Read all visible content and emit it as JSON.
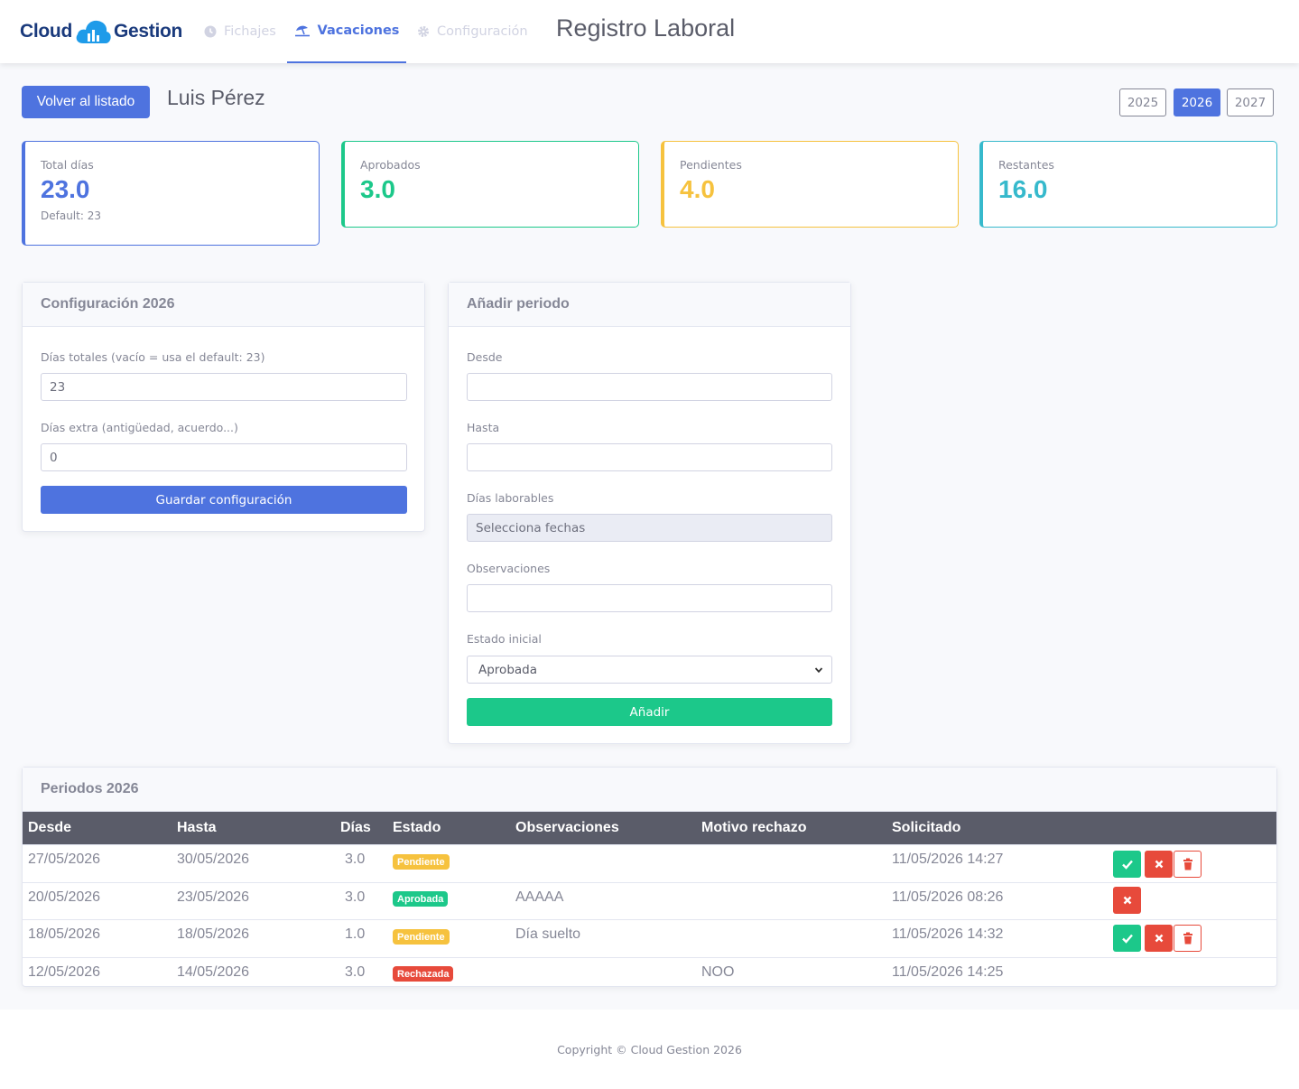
{
  "app": {
    "logo_left": "Cloud",
    "logo_right": "Gestion",
    "page_title": "Registro Laboral"
  },
  "nav": {
    "fichajes": "Fichajes",
    "vacaciones": "Vacaciones",
    "configuracion": "Configuración"
  },
  "header": {
    "back_label": "Volver al listado",
    "employee_name": "Luis Pérez",
    "years": [
      "2025",
      "2026",
      "2027"
    ],
    "active_year": "2026"
  },
  "stats": {
    "total": {
      "label": "Total días",
      "value": "23.0",
      "sub": "Default: 23",
      "color": "#4e73df"
    },
    "aprobados": {
      "label": "Aprobados",
      "value": "3.0",
      "color": "#1cc88a"
    },
    "pendientes": {
      "label": "Pendientes",
      "value": "4.0",
      "color": "#f6c23e"
    },
    "restantes": {
      "label": "Restantes",
      "value": "16.0",
      "color": "#36b9cc"
    }
  },
  "config_card": {
    "title": "Configuración 2026",
    "dias_totales_label": "Días totales (vacío = usa el default: 23)",
    "dias_totales_value": "23",
    "dias_extra_label": "Días extra (antigüedad, acuerdo...)",
    "dias_extra_value": "0",
    "save_label": "Guardar configuración"
  },
  "add_card": {
    "title": "Añadir periodo",
    "desde_label": "Desde",
    "desde_value": "",
    "hasta_label": "Hasta",
    "hasta_value": "",
    "laborables_label": "Días laborables",
    "laborables_value": "Selecciona fechas",
    "observaciones_label": "Observaciones",
    "observaciones_value": "",
    "estado_label": "Estado inicial",
    "estado_value": "Aprobada",
    "add_label": "Añadir"
  },
  "periods": {
    "title": "Periodos 2026",
    "columns": [
      "Desde",
      "Hasta",
      "Días",
      "Estado",
      "Observaciones",
      "Motivo rechazo",
      "Solicitado"
    ],
    "rows": [
      {
        "desde": "27/05/2026",
        "hasta": "30/05/2026",
        "dias": "3.0",
        "estado": "Pendiente",
        "obs": "",
        "motivo": "",
        "solicitado": "11/05/2026 14:27"
      },
      {
        "desde": "20/05/2026",
        "hasta": "23/05/2026",
        "dias": "3.0",
        "estado": "Aprobada",
        "obs": "AAAAA",
        "motivo": "",
        "solicitado": "11/05/2026 08:26"
      },
      {
        "desde": "18/05/2026",
        "hasta": "18/05/2026",
        "dias": "1.0",
        "estado": "Pendiente",
        "obs": "Día suelto",
        "motivo": "",
        "solicitado": "11/05/2026 14:32"
      },
      {
        "desde": "12/05/2026",
        "hasta": "14/05/2026",
        "dias": "3.0",
        "estado": "Rechazada",
        "obs": "",
        "motivo": "NOO",
        "solicitado": "11/05/2026 14:25"
      }
    ],
    "status_colors": {
      "Pendiente": "#f6c23e",
      "Aprobada": "#1cc88a",
      "Rechazada": "#e74a3b"
    }
  },
  "footer": {
    "copyright": "Copyright © Cloud Gestion 2026"
  }
}
